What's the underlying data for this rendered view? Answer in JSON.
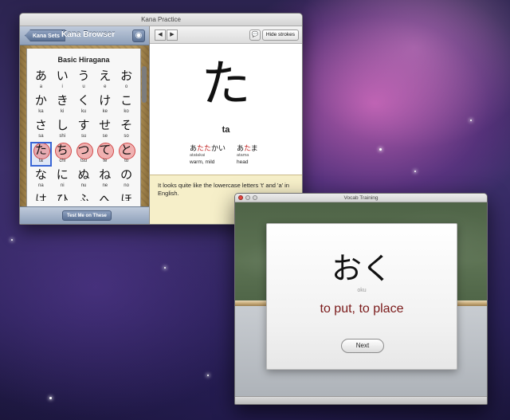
{
  "practice_window": {
    "title": "Kana Practice",
    "sidebar": {
      "back_label": "Kana Sets",
      "title": "Kana Browser",
      "panel_title": "Basic Hiragana",
      "kana": [
        {
          "kana": "あ",
          "romaji": "a"
        },
        {
          "kana": "い",
          "romaji": "i"
        },
        {
          "kana": "う",
          "romaji": "u"
        },
        {
          "kana": "え",
          "romaji": "e"
        },
        {
          "kana": "お",
          "romaji": "o"
        },
        {
          "kana": "か",
          "romaji": "ka"
        },
        {
          "kana": "き",
          "romaji": "ki"
        },
        {
          "kana": "く",
          "romaji": "ku"
        },
        {
          "kana": "け",
          "romaji": "ke"
        },
        {
          "kana": "こ",
          "romaji": "ko"
        },
        {
          "kana": "さ",
          "romaji": "sa"
        },
        {
          "kana": "し",
          "romaji": "shi"
        },
        {
          "kana": "す",
          "romaji": "su"
        },
        {
          "kana": "せ",
          "romaji": "se"
        },
        {
          "kana": "そ",
          "romaji": "so"
        },
        {
          "kana": "た",
          "romaji": "ta"
        },
        {
          "kana": "ち",
          "romaji": "chi"
        },
        {
          "kana": "つ",
          "romaji": "tsu"
        },
        {
          "kana": "て",
          "romaji": "te"
        },
        {
          "kana": "と",
          "romaji": "to"
        },
        {
          "kana": "な",
          "romaji": "na"
        },
        {
          "kana": "に",
          "romaji": "ni"
        },
        {
          "kana": "ぬ",
          "romaji": "nu"
        },
        {
          "kana": "ね",
          "romaji": "ne"
        },
        {
          "kana": "の",
          "romaji": "no"
        },
        {
          "kana": "は",
          "romaji": ""
        },
        {
          "kana": "ひ",
          "romaji": ""
        },
        {
          "kana": "ふ",
          "romaji": ""
        },
        {
          "kana": "へ",
          "romaji": ""
        },
        {
          "kana": "ほ",
          "romaji": ""
        }
      ],
      "test_button": "Test Me on These"
    },
    "toolbar": {
      "prev_icon": "◀",
      "next_icon": "▶",
      "speech_icon": "💬",
      "hide_strokes": "Hide strokes"
    },
    "detail": {
      "kana": "た",
      "romaji": "ta",
      "examples": [
        {
          "pre": "あ",
          "hl": "たた",
          "post": "かい",
          "romaji": "atatakai",
          "meaning": "warm, mild"
        },
        {
          "pre": "あ",
          "hl": "た",
          "post": "ま",
          "romaji": "atama",
          "meaning": "head"
        }
      ],
      "note": "It looks quite like the lowercase letters 't' and 'a' in English."
    }
  },
  "vocab_window": {
    "title": "Vocab Training",
    "card": {
      "word": "おく",
      "romaji": "oku",
      "meaning": "to put, to place"
    },
    "next_button": "Next"
  },
  "colors": {
    "highlight_red": "#c01d1d",
    "meaning_color": "#7a1a1a",
    "selection_blue": "#3a66d6"
  }
}
